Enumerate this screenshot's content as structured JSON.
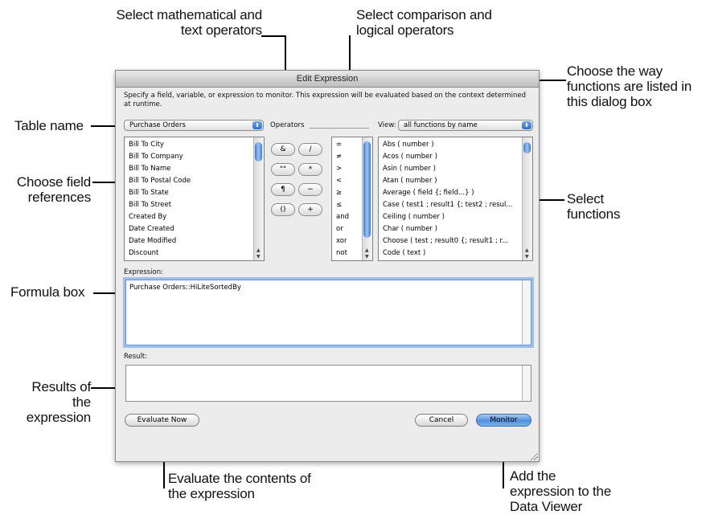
{
  "dialog": {
    "title": "Edit Expression",
    "description": "Specify a field, variable, or expression to monitor. This expression will be evaluated based on the context determined at runtime.",
    "table_select": "Purchase Orders",
    "operators_label": "Operators",
    "view_label": "View:",
    "view_select": "all functions by name",
    "fields": [
      "Bill To City",
      "Bill To Company",
      "Bill To Name",
      "Bill To Postal Code",
      "Bill To State",
      "Bill To Street",
      "Created By",
      "Date Created",
      "Date Modified",
      "Discount"
    ],
    "operator_buttons": [
      "&",
      "/",
      "\"\"",
      "*",
      "¶",
      "−",
      "()",
      "+"
    ],
    "comparison_ops": [
      "=",
      "≠",
      ">",
      "<",
      "≥",
      "≤",
      "and",
      "or",
      "xor",
      "not"
    ],
    "functions": [
      "Abs ( number )",
      "Acos ( number )",
      "Asin ( number )",
      "Atan ( number )",
      "Average ( field {; field...} )",
      "Case ( test1 ; result1 {; test2 ; resul...",
      "Ceiling ( number )",
      "Char ( number )",
      "Choose ( test ; result0 {; result1 ; r...",
      "Code ( text )"
    ],
    "expression_label": "Expression:",
    "expression_value": "Purchase Orders::HiLiteSortedBy",
    "result_label": "Result:",
    "result_value": "",
    "evaluate_button": "Evaluate Now",
    "cancel_button": "Cancel",
    "monitor_button": "Monitor"
  },
  "callouts": {
    "math_ops": [
      "Select mathematical and",
      "text operators"
    ],
    "comparison_ops": [
      "Select comparison and",
      "logical operators"
    ],
    "view_way": [
      "Choose the way",
      "functions are listed in",
      "this dialog box"
    ],
    "table_name": "Table name",
    "field_refs": [
      "Choose field",
      "references"
    ],
    "select_functions": [
      "Select",
      "functions"
    ],
    "formula_box": "Formula box",
    "results": [
      "Results of",
      "the",
      "expression"
    ],
    "evaluate": [
      "Evaluate the contents of",
      "the expression"
    ],
    "add": [
      "Add the",
      "expression to the",
      "Data Viewer"
    ]
  }
}
